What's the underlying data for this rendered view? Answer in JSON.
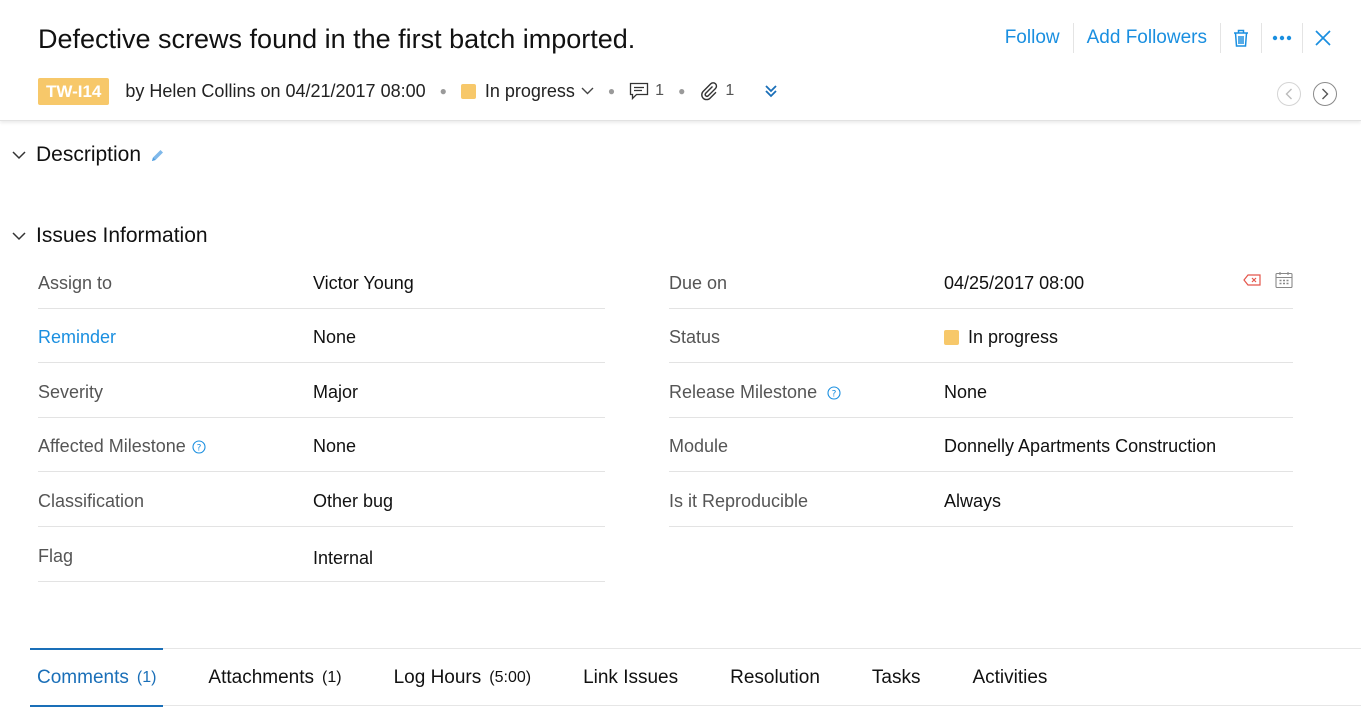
{
  "header": {
    "title": "Defective screws found in the first batch imported.",
    "follow_label": "Follow",
    "add_followers_label": "Add Followers",
    "issue_key": "TW-I14",
    "reported_by": "by Helen Collins on 04/21/2017 08:00",
    "status": "In progress",
    "comment_count": "1",
    "attachment_count": "1"
  },
  "sections": {
    "description": "Description",
    "issues_information": "Issues Information"
  },
  "fields_left": [
    {
      "label": "Assign to",
      "value": "Victor Young"
    },
    {
      "label": "Reminder",
      "value": "None"
    },
    {
      "label": "Severity",
      "value": "Major"
    },
    {
      "label": "Affected Milestone",
      "value": "None"
    },
    {
      "label": "Classification",
      "value": "Other bug"
    },
    {
      "label": "Flag",
      "value": "Internal"
    }
  ],
  "fields_right": [
    {
      "label": "Due on",
      "value": "04/25/2017 08:00"
    },
    {
      "label": "Status",
      "value": "In progress"
    },
    {
      "label": "Release Milestone",
      "value": "None"
    },
    {
      "label": "Module",
      "value": "Donnelly Apartments Construction"
    },
    {
      "label": "Is it Reproducible",
      "value": "Always"
    }
  ],
  "tabs": [
    {
      "label": "Comments",
      "count": "(1)"
    },
    {
      "label": "Attachments",
      "count": "(1)"
    },
    {
      "label": "Log Hours",
      "count": "(5:00)"
    },
    {
      "label": "Link Issues",
      "count": ""
    },
    {
      "label": "Resolution",
      "count": ""
    },
    {
      "label": "Tasks",
      "count": ""
    },
    {
      "label": "Activities",
      "count": ""
    }
  ],
  "colors": {
    "accent": "#1a8fe0",
    "status_in_progress": "#f7c86a",
    "active_tab": "#1a6fb8"
  },
  "icons": [
    "trash-icon",
    "more-icon",
    "close-icon",
    "comment-icon",
    "paperclip-icon",
    "expand-more-icon",
    "prev-icon",
    "next-icon",
    "chevron-down-icon",
    "pencil-icon",
    "help-icon",
    "clear-icon",
    "calendar-icon"
  ]
}
